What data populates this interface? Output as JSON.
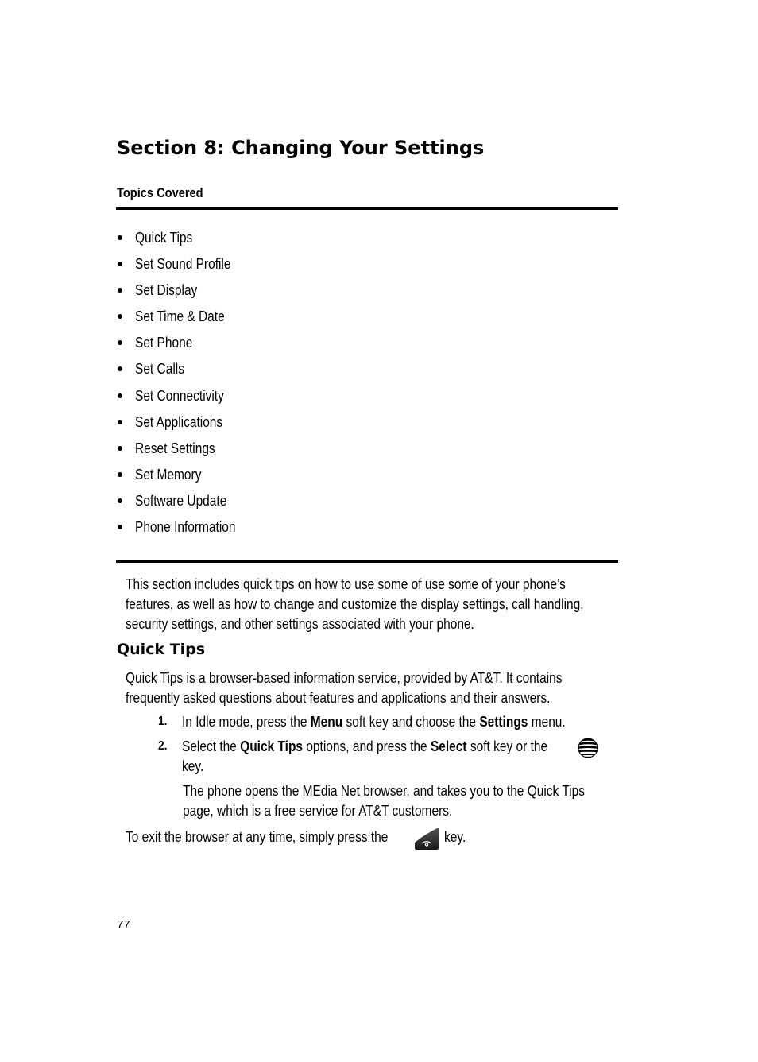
{
  "page": {
    "section_title": "Section 8: Changing Your Settings",
    "topics_heading": "Topics Covered",
    "topics": [
      "Quick Tips",
      "Set Sound Profile",
      "Set Display",
      "Set Time & Date",
      "Set Phone",
      "Set Calls",
      "Set Connectivity",
      "Set Applications",
      "Reset Settings",
      "Set Memory",
      "Software Update",
      "Phone Information"
    ],
    "intro_lines": [
      "This section includes quick tips on how to use some of use some of your phone’s",
      "features, as well as how to change and customize the display settings, call handling,",
      "security settings, and other settings associated with your phone."
    ],
    "quick_tips": {
      "heading": "Quick Tips",
      "intro_lines": [
        "Quick Tips is a browser-based information service, provided by AT&T. It contains",
        "frequently asked questions about features and applications and their answers."
      ],
      "steps": [
        {
          "number": "1.",
          "parts": [
            {
              "text": "In Idle mode, press the ",
              "bold": false
            },
            {
              "text": "Menu",
              "bold": true
            },
            {
              "text": " soft key and choose the ",
              "bold": false
            },
            {
              "text": "Settings",
              "bold": true
            },
            {
              "text": " menu.",
              "bold": false
            }
          ]
        },
        {
          "number": "2.",
          "parts": [
            {
              "text": "Select the ",
              "bold": false
            },
            {
              "text": "Quick Tips",
              "bold": true
            },
            {
              "text": " options, and press the ",
              "bold": false
            },
            {
              "text": "Select",
              "bold": true
            },
            {
              "text": " soft key or the",
              "bold": false
            }
          ],
          "icon": "att-globe-key-icon",
          "continuation": "key.",
          "note_lines": [
            "The phone opens the MEdia Net browser, and takes you to the Quick Tips",
            "page, which is a free service for AT&T customers."
          ]
        }
      ],
      "exit_before": "To exit the browser at any time, simply press the",
      "exit_icon": "end-key-icon",
      "exit_after": "key."
    },
    "page_number": "77"
  }
}
